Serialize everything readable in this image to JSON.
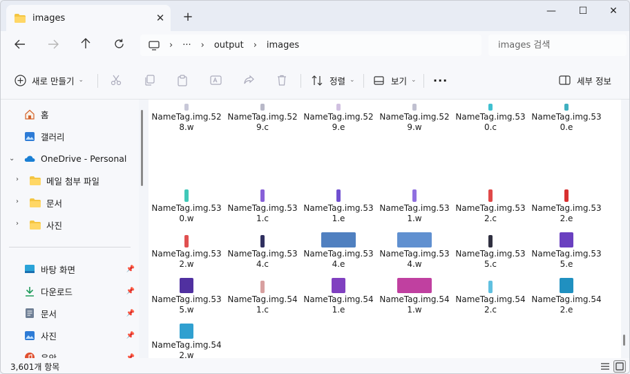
{
  "tab": {
    "title": "images",
    "close": "✕",
    "new_tab": "+"
  },
  "window_controls": {
    "minimize": "—",
    "maximize": "☐",
    "close": "✕"
  },
  "address": {
    "path": [
      "output",
      "images"
    ],
    "ellipsis": "···",
    "separator": "›",
    "search_placeholder": "images 검색"
  },
  "toolbar": {
    "new": "새로 만들기",
    "sort": "정렬",
    "view": "보기",
    "more": "···",
    "details": "세부 정보"
  },
  "sidebar": {
    "items": [
      {
        "label": "홈",
        "icon": "home-icon"
      },
      {
        "label": "갤러리",
        "icon": "gallery-icon"
      },
      {
        "label": "OneDrive - Personal",
        "icon": "onedrive-icon",
        "expanded": true
      },
      {
        "label": "메일 첨부 파일",
        "icon": "folder-icon"
      },
      {
        "label": "문서",
        "icon": "folder-icon"
      },
      {
        "label": "사진",
        "icon": "folder-icon"
      }
    ],
    "quick_access": [
      {
        "label": "바탕 화면",
        "icon": "desktop-icon"
      },
      {
        "label": "다운로드",
        "icon": "download-icon"
      },
      {
        "label": "문서",
        "icon": "documents-icon"
      },
      {
        "label": "사진",
        "icon": "pictures-icon"
      },
      {
        "label": "음악",
        "icon": "music-icon"
      }
    ]
  },
  "files": [
    {
      "line1": "NameTag.img.52",
      "line2": "8.w",
      "color": "#c8c8d8"
    },
    {
      "line1": "NameTag.img.52",
      "line2": "9.c",
      "color": "#b8b8c8"
    },
    {
      "line1": "NameTag.img.52",
      "line2": "9.e",
      "color": "#d0c0e0"
    },
    {
      "line1": "NameTag.img.52",
      "line2": "9.w",
      "color": "#c0c0d0"
    },
    {
      "line1": "NameTag.img.53",
      "line2": "0.c",
      "color": "#40c0d0"
    },
    {
      "line1": "NameTag.img.53",
      "line2": "0.e",
      "color": "#40b0c0"
    },
    {
      "line1": "NameTag.img.53",
      "line2": "0.w",
      "color": "#40c8b8"
    },
    {
      "line1": "NameTag.img.53",
      "line2": "1.c",
      "color": "#8860d8"
    },
    {
      "line1": "NameTag.img.53",
      "line2": "1.e",
      "color": "#7050d0"
    },
    {
      "line1": "NameTag.img.53",
      "line2": "1.w",
      "color": "#9070e0"
    },
    {
      "line1": "NameTag.img.53",
      "line2": "2.c",
      "color": "#e04848"
    },
    {
      "line1": "NameTag.img.53",
      "line2": "2.e",
      "color": "#d83030"
    },
    {
      "line1": "NameTag.img.53",
      "line2": "2.w",
      "color": "#e05050"
    },
    {
      "line1": "NameTag.img.53",
      "line2": "4.c",
      "color": "#303060"
    },
    {
      "line1": "NameTag.img.53",
      "line2": "4.e",
      "color": "#5080c0"
    },
    {
      "line1": "NameTag.img.53",
      "line2": "4.w",
      "color": "#6090d0"
    },
    {
      "line1": "NameTag.img.53",
      "line2": "5.c",
      "color": "#303040"
    },
    {
      "line1": "NameTag.img.53",
      "line2": "5.e",
      "color": "#6a40c0"
    },
    {
      "line1": "NameTag.img.53",
      "line2": "5.w",
      "color": "#5030a0"
    },
    {
      "line1": "NameTag.img.54",
      "line2": "1.c",
      "color": "#d8a0a0"
    },
    {
      "line1": "NameTag.img.54",
      "line2": "1.e",
      "color": "#8040c0"
    },
    {
      "line1": "NameTag.img.54",
      "line2": "1.w",
      "color": "#c040a0"
    },
    {
      "line1": "NameTag.img.54",
      "line2": "2.c",
      "color": "#60c0e0"
    },
    {
      "line1": "NameTag.img.54",
      "line2": "2.e",
      "color": "#2090c0"
    },
    {
      "line1": "NameTag.img.54",
      "line2": "2.w",
      "color": "#30a0d0"
    }
  ],
  "status": {
    "count": "3,601개 항목"
  },
  "colors": {
    "accent": "#0067c0",
    "folder": "#f4c542"
  }
}
